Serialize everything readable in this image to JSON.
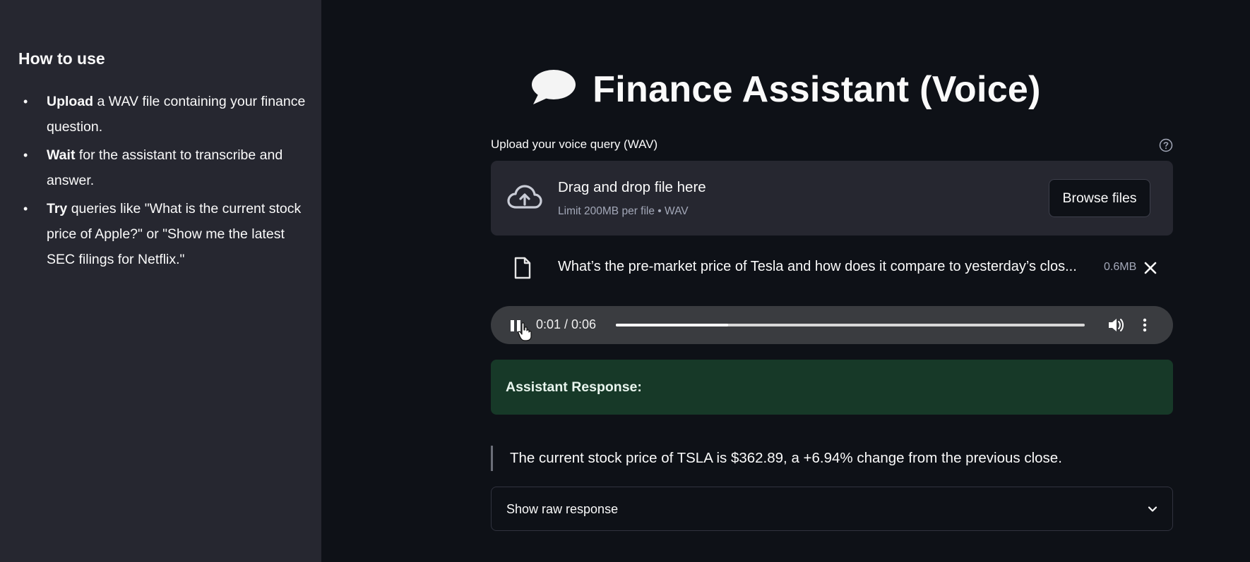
{
  "sidebar": {
    "heading": "How to use",
    "items": [
      {
        "strong": "Upload",
        "text": " a WAV file containing your finance question."
      },
      {
        "strong": "Wait",
        "text": " for the assistant to transcribe and answer."
      },
      {
        "strong": "Try",
        "text": " queries like \"What is the current stock price of Apple?\" or \"Show me the latest SEC filings for Netflix.\""
      }
    ]
  },
  "main": {
    "title": "Finance Assistant (Voice)",
    "title_icon": "speech-bubble-icon",
    "uploader": {
      "label": "Upload your voice query (WAV)",
      "drop_title": "Drag and drop file here",
      "drop_limit": "Limit 200MB per file • WAV",
      "browse_label": "Browse files"
    },
    "file": {
      "name": "What’s the pre-market price of Tesla and how does it compare to yesterday’s clos...",
      "size": "0.6MB"
    },
    "audio": {
      "time": "0:01 / 0:06",
      "progress": 0.24,
      "state": "playing"
    },
    "response": {
      "title": "Assistant Response:",
      "text": "The current stock price of TSLA is $362.89, a +6.94% change from the previous close."
    },
    "expander": {
      "label": "Show raw response"
    }
  },
  "colors": {
    "background": "#0e1117",
    "sidebar": "#262730",
    "success_bg": "#173928",
    "player_bg": "#3a3c40"
  }
}
